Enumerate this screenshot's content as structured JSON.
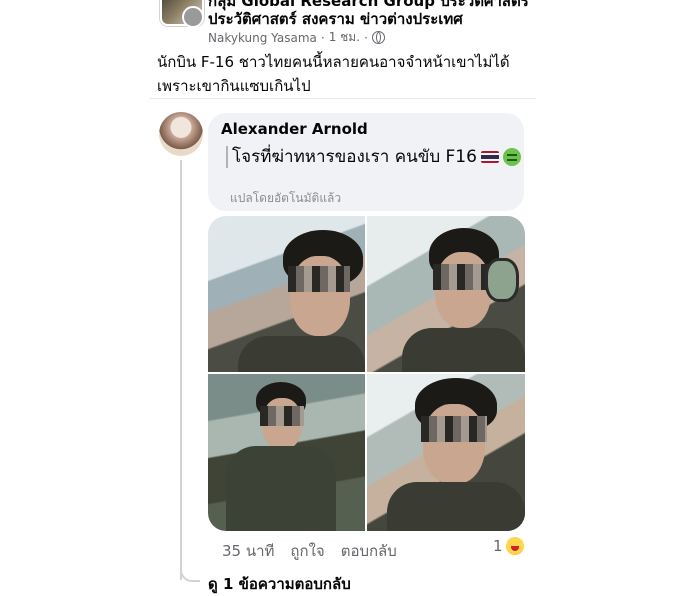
{
  "header": {
    "group_line1": "กลุ่ม Global Research Group ประวัติศาสตร์",
    "group_line2": "ประวัติศาสตร์ สงคราม ข่าวต่างประเทศ",
    "author": "Nakykung Yasama",
    "time": "1 ชม.",
    "separator": "·"
  },
  "post": {
    "text": "นักบิน F-16 ชาวไทยคนนี้หลายคนอาจจำหน้าเขาไม่ได้ เพราะเขากินแซบเกินไป"
  },
  "comment": {
    "author": "Alexander Arnold",
    "text": "โจรที่ฆ่าทหารของเรา คนขับ F16",
    "emoji_icons": [
      "thailand-flag-icon",
      "nauseated-face-icon"
    ],
    "translated_note": "แปลโดยอัตโนมัติแล้ว",
    "time": "35 นาที",
    "like_label": "ถูกใจ",
    "reply_label": "ตอบกลับ",
    "reaction_count": "1",
    "reaction_icon": "haha-icon",
    "view_replies": "ดู 1 ข้อความตอบกลับ"
  },
  "photos": [
    {
      "name": "photo-1"
    },
    {
      "name": "photo-2"
    },
    {
      "name": "photo-3"
    },
    {
      "name": "photo-4"
    }
  ]
}
